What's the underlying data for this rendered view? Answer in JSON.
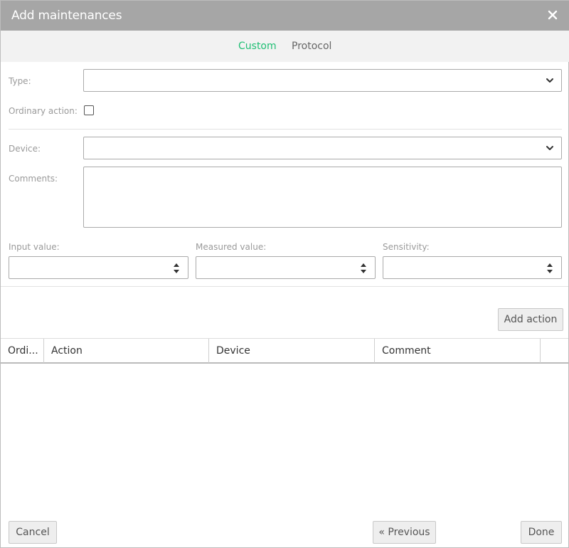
{
  "dialog": {
    "title": "Add maintenances",
    "close_icon": "close-icon"
  },
  "tabs": [
    {
      "label": "Custom",
      "active": true
    },
    {
      "label": "Protocol",
      "active": false
    }
  ],
  "form": {
    "type_label": "Type:",
    "type_value": "",
    "ordinary_label": "Ordinary action:",
    "ordinary_checked": false,
    "device_label": "Device:",
    "device_value": "",
    "comments_label": "Comments:",
    "comments_value": "",
    "input_value_label": "Input value:",
    "measured_value_label": "Measured value:",
    "sensitivity_label": "Sensitivity:"
  },
  "actions": {
    "add_action_label": "Add action"
  },
  "grid": {
    "columns": [
      "Ordi...",
      "Action",
      "Device",
      "Comment",
      ""
    ],
    "rows": []
  },
  "footer": {
    "cancel_label": "Cancel",
    "previous_label": "« Previous",
    "done_label": "Done"
  },
  "colors": {
    "accent": "#1fbf74",
    "titlebar": "#a6a6a6"
  }
}
